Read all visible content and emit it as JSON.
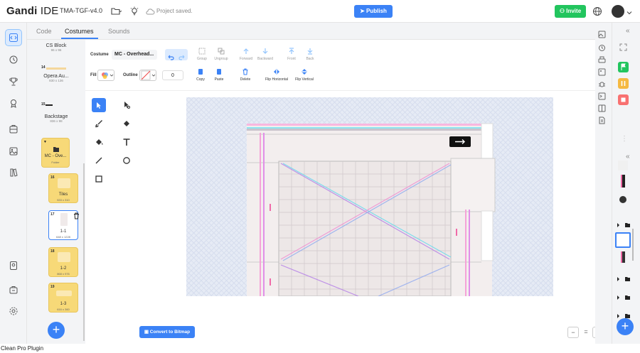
{
  "app": {
    "logo_bold": "Gandi",
    "logo_light": " IDE",
    "project_name": "TMA-TGF-v4.0",
    "status": "Project saved.",
    "publish_label": "Publish",
    "invite_label": "Invite"
  },
  "tabs": [
    {
      "label": "Code"
    },
    {
      "label": "Costumes"
    },
    {
      "label": "Sounds"
    }
  ],
  "costumes": {
    "items": [
      {
        "name": "CS Block",
        "size": "96 x 96"
      },
      {
        "num": "14",
        "name": "Opera Au...",
        "size": "830 x 136"
      },
      {
        "num": "15",
        "name": "Backstage",
        "size": "836 x 98"
      }
    ],
    "folder": {
      "name": "MC - Ove...",
      "type": "Folder"
    },
    "cards": [
      {
        "num": "16",
        "name": "Tiles",
        "size": "533 x 310"
      },
      {
        "num": "17",
        "name": "1-1",
        "size": "648 x 1228"
      },
      {
        "num": "18",
        "name": "1-2",
        "size": "868 x 976"
      },
      {
        "num": "19",
        "name": "1-3",
        "size": "616 x 360"
      }
    ],
    "add_label": "+"
  },
  "toolbar": {
    "costume_label": "Costume",
    "costume_name": "MC - Overhead...",
    "group": "Group",
    "ungroup": "Ungroup",
    "forward": "Forward",
    "backward": "Backward",
    "front": "Front",
    "back": "Back",
    "fill_label": "Fill",
    "outline_label": "Outline",
    "outline_width": "0",
    "copy": "Copy",
    "paste": "Paste",
    "delete": "Delete",
    "flip_h": "Flip Horizontal",
    "flip_v": "Flip Vertical"
  },
  "editor": {
    "convert_label": "Convert to Bitmap",
    "zoom_out": "−",
    "zoom_reset": "=",
    "zoom_in": "+"
  },
  "footer": {
    "text": "Clean Pro Plugin"
  },
  "colors": {
    "accent": "#3b82f6",
    "invite": "#22c55e",
    "folder": "#f7d978",
    "stage_flag": "#22c55e",
    "stage_pause": "#f5b942",
    "stage_stop": "#f87171"
  }
}
